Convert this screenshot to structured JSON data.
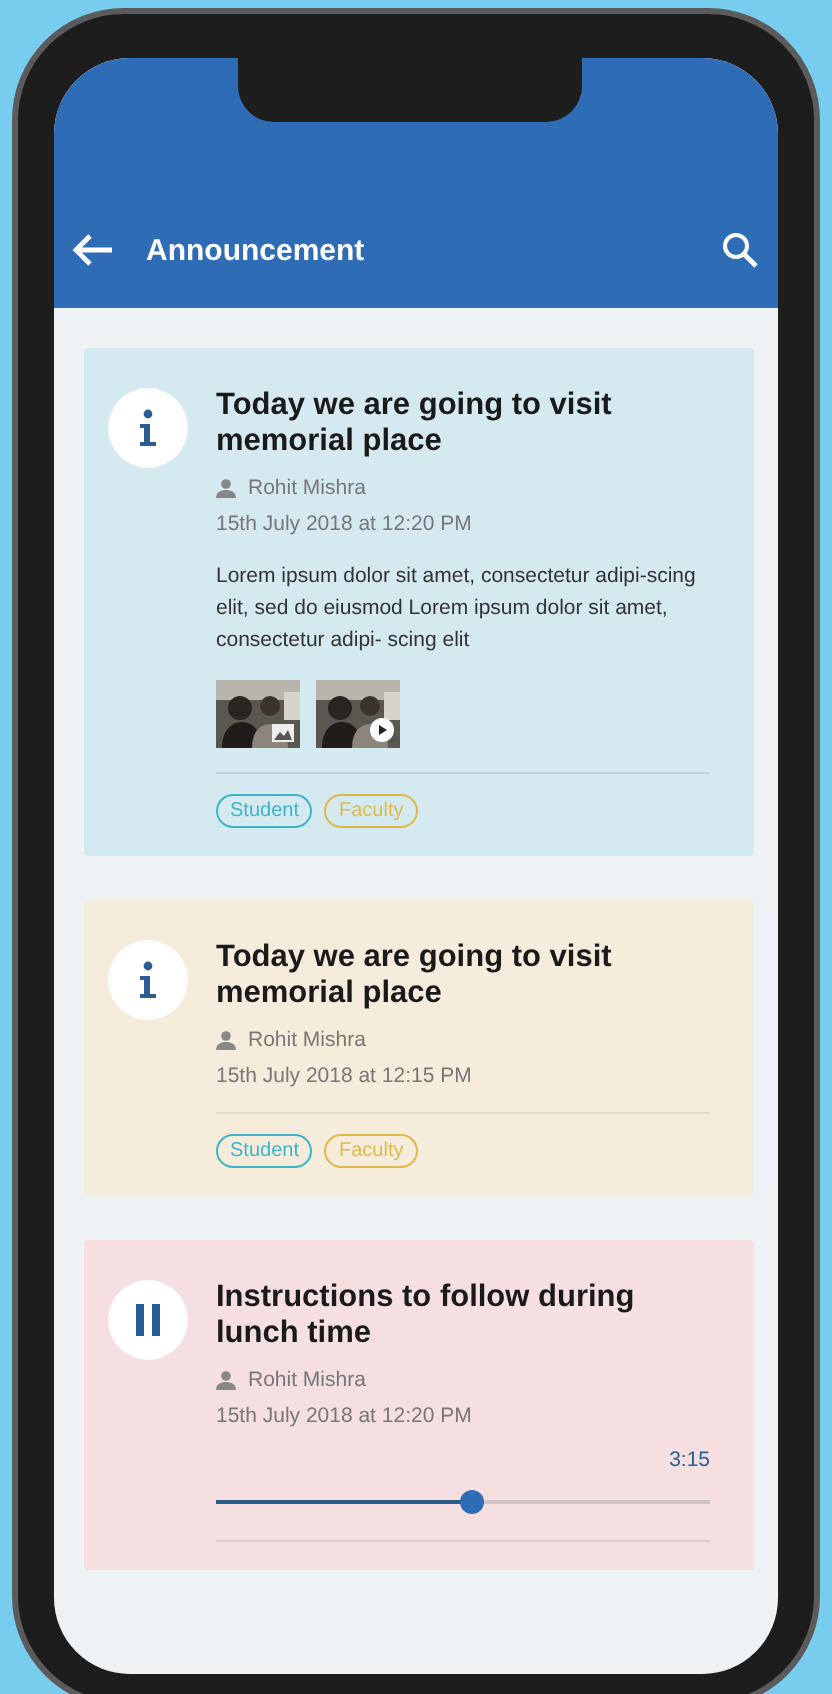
{
  "app_bar": {
    "title": "Announcement"
  },
  "cards": [
    {
      "kind": "info",
      "title": "Today we are going to visit memorial place",
      "author": "Rohit Mishra",
      "date": "15th July 2018 at 12:20 PM",
      "body": "Lorem ipsum dolor sit amet, consectetur adipi-scing elit, sed do eiusmod Lorem ipsum dolor sit amet, consectetur adipi- scing elit",
      "color": "#d5e9f1",
      "thumbnails": [
        {
          "kind": "picture",
          "video": false
        },
        {
          "kind": "picture",
          "video": true
        }
      ],
      "tags": [
        {
          "label": "Student",
          "color": "#3fb4c8"
        },
        {
          "label": "Faculty",
          "color": "#e0b94a"
        }
      ]
    },
    {
      "kind": "info",
      "title": "Today we are going to visit memorial place",
      "author": "Rohit Mishra",
      "date": "15th July 2018 at 12:15 PM",
      "color": "#f6ecdb",
      "tags": [
        {
          "label": "Student",
          "color": "#3fb4c8"
        },
        {
          "label": "Faculty",
          "color": "#e0b94a"
        }
      ]
    },
    {
      "kind": "audio",
      "title": "Instructions to follow during lunch time",
      "author": "Rohit Mishra",
      "date": "15th July 2018 at 12:20 PM",
      "color": "#f5dfe0",
      "duration": "3:15",
      "level": 0.52
    }
  ]
}
